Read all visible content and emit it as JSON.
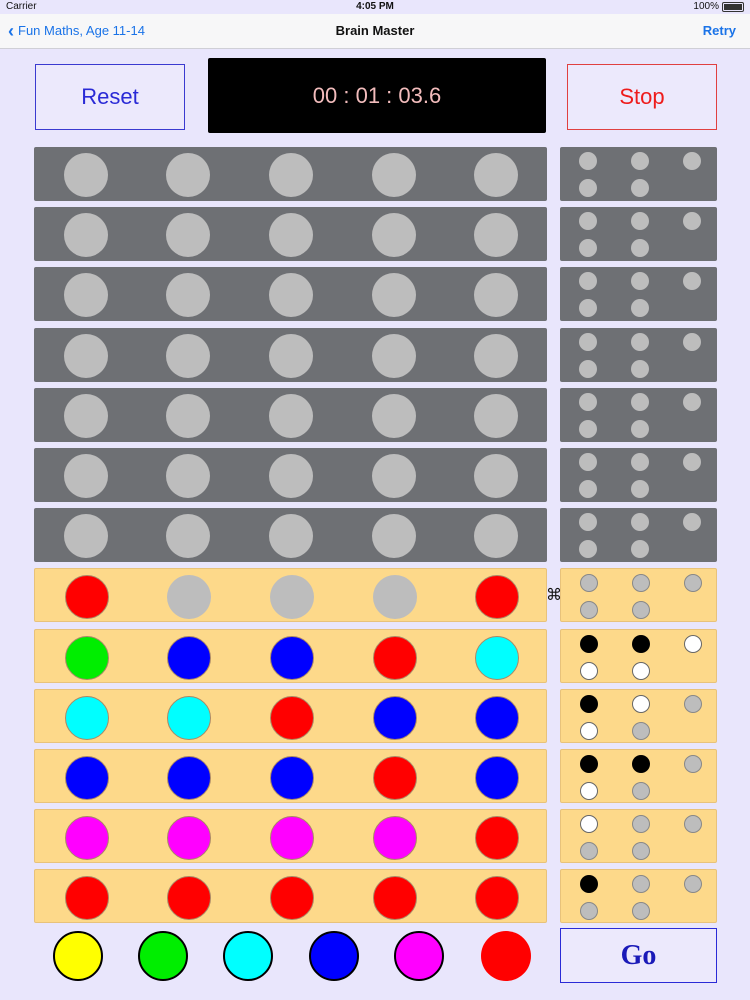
{
  "status": {
    "carrier": "Carrier",
    "time": "4:05 PM",
    "battery": "100%"
  },
  "nav": {
    "back_label": "Fun Maths, Age 11-14",
    "title": "Brain Master",
    "retry_label": "Retry"
  },
  "controls": {
    "reset_label": "Reset",
    "timer": "00 : 01 : 03.6",
    "stop_label": "Stop",
    "go_label": "Go"
  },
  "colors": {
    "red": "#ff0000",
    "green": "#00ee00",
    "blue": "#0000ff",
    "cyan": "#00ffff",
    "magenta": "#ff00ff",
    "yellow": "#ffff00",
    "empty": "#bdbdbd"
  },
  "empty_rows": 7,
  "guesses": [
    {
      "pegs": [
        "red",
        "empty",
        "empty",
        "empty",
        "red"
      ],
      "feedback": [
        "empty",
        "empty",
        "empty",
        "empty",
        "empty"
      ]
    },
    {
      "pegs": [
        "green",
        "blue",
        "blue",
        "red",
        "cyan"
      ],
      "feedback": [
        "black",
        "black",
        "white",
        "white",
        "white"
      ]
    },
    {
      "pegs": [
        "cyan",
        "cyan",
        "red",
        "blue",
        "blue"
      ],
      "feedback": [
        "black",
        "white",
        "empty",
        "white",
        "empty"
      ]
    },
    {
      "pegs": [
        "blue",
        "blue",
        "blue",
        "red",
        "blue"
      ],
      "feedback": [
        "black",
        "black",
        "empty",
        "white",
        "empty"
      ]
    },
    {
      "pegs": [
        "magenta",
        "magenta",
        "magenta",
        "magenta",
        "red"
      ],
      "feedback": [
        "white",
        "empty",
        "empty",
        "empty",
        "empty"
      ]
    },
    {
      "pegs": [
        "red",
        "red",
        "red",
        "red",
        "red"
      ],
      "feedback": [
        "black",
        "empty",
        "empty",
        "empty",
        "empty"
      ]
    }
  ],
  "palette": [
    "yellow",
    "green",
    "cyan",
    "blue",
    "magenta",
    "red"
  ],
  "cursor_glyph": "⌘"
}
